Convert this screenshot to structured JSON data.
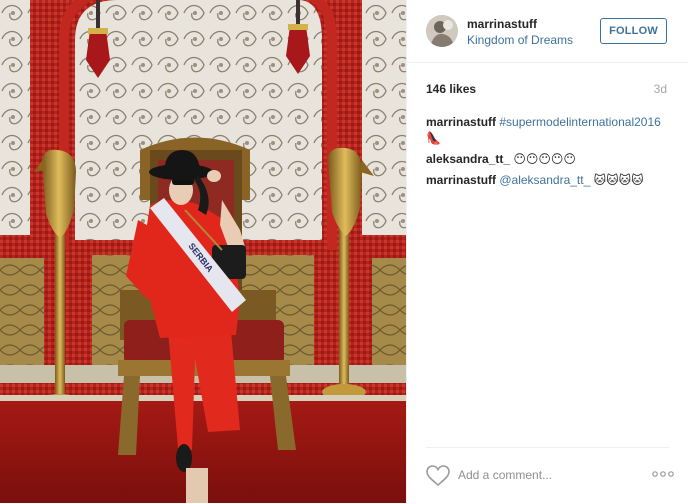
{
  "post": {
    "username": "marrinastuff",
    "location": "Kingdom of Dreams",
    "follow_label": "FOLLOW",
    "likes": "146 likes",
    "time": "3d"
  },
  "comments": [
    {
      "user": "marrinastuff",
      "tag": "#supermodelinternational2016",
      "text": "👠"
    },
    {
      "user": "aleksandra_tt_",
      "tag": "",
      "text": "😶😶😶😶😶"
    },
    {
      "user": "marrinastuff",
      "tag": "@aleksandra_tt_",
      "text": "🐱🐱🐱🐱"
    }
  ],
  "footer": {
    "comment_placeholder": "Add a comment...",
    "like_icon": "heart-icon",
    "more_icon": "ellipsis-icon"
  },
  "photo": {
    "sash_text": "SERBIA"
  },
  "colors": {
    "link": "#3f729b",
    "text": "#262626",
    "muted": "#a5a7aa",
    "dress": "#e1261c",
    "wall_red": "#b4231c",
    "gold": "#b8922e"
  }
}
